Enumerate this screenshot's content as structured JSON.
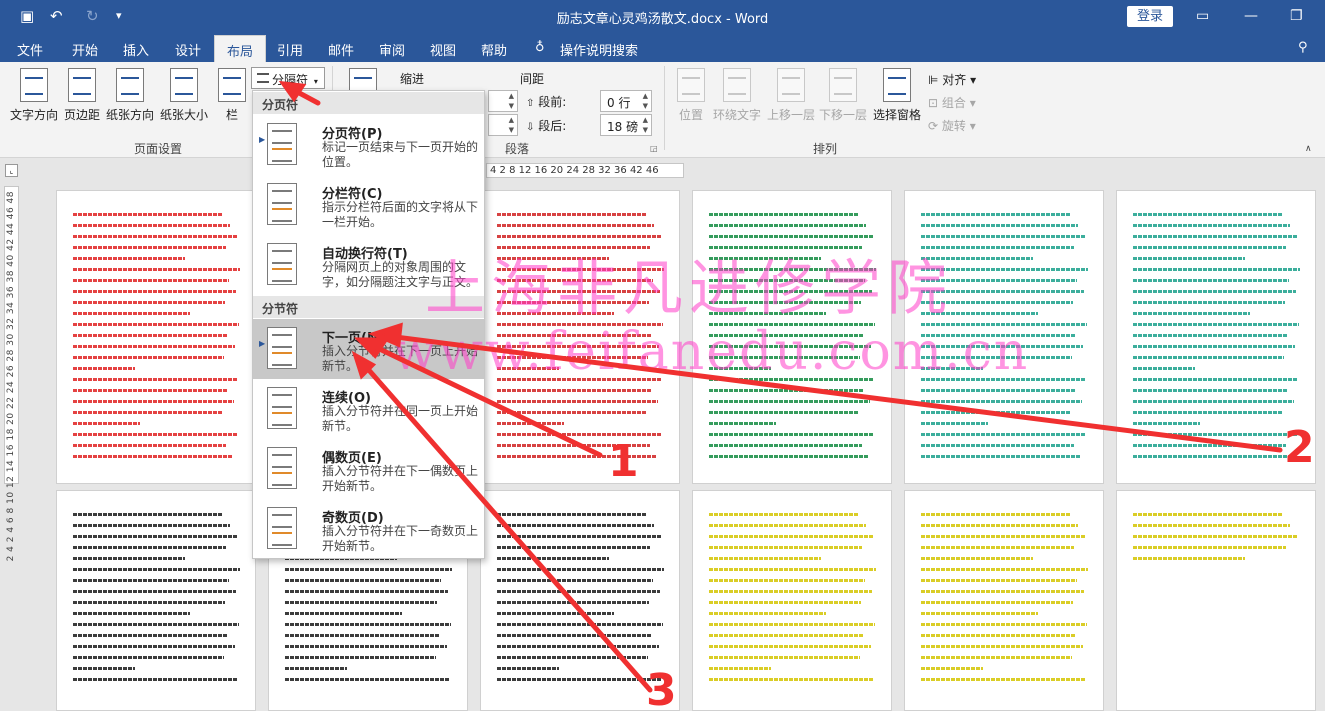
{
  "app": {
    "title": "励志文章心灵鸡汤散文.docx - Word",
    "login_label": "登录",
    "search_tab": "操作说明搜索"
  },
  "tabs": [
    {
      "label": "文件"
    },
    {
      "label": "开始"
    },
    {
      "label": "插入"
    },
    {
      "label": "设计"
    },
    {
      "label": "布局",
      "active": true
    },
    {
      "label": "引用"
    },
    {
      "label": "邮件"
    },
    {
      "label": "审阅"
    },
    {
      "label": "视图"
    },
    {
      "label": "帮助"
    }
  ],
  "ribbon": {
    "page_setup": {
      "group_label": "页面设置",
      "buttons": [
        "文字方向",
        "页边距",
        "纸张方向",
        "纸张大小",
        "栏"
      ],
      "breaks_button": "分隔符"
    },
    "indent": {
      "label": "缩进"
    },
    "spacing": {
      "label": "间距",
      "before_label": "段前:",
      "before_value": "0 行",
      "after_label": "段后:",
      "after_value": "18 磅"
    },
    "paragraph_group_label": "段落",
    "arrange": {
      "group_label": "排列",
      "buttons": [
        "位置",
        "环绕文字",
        "上移一层",
        "下移一层",
        "选择窗格"
      ],
      "align": "对齐",
      "group": "组合",
      "rotate": "旋转"
    }
  },
  "ruler": {
    "horizontal_ticks": "4  2  8 12 16 20 24 28 32 36  42 46",
    "vertical_ticks": "2 4 2 4 6 8 10 12 14 16 18 20 22 24 26 28 30 32 34 36 38 40 42 44 46 48"
  },
  "breaks_menu": {
    "page_breaks_header": "分页符",
    "section_breaks_header": "分节符",
    "items": [
      {
        "title": "分页符(P)",
        "desc": "标记一页结束与下一页开始的位置。"
      },
      {
        "title": "分栏符(C)",
        "desc": "指示分栏符后面的文字将从下一栏开始。"
      },
      {
        "title": "自动换行符(T)",
        "desc": "分隔网页上的对象周围的文字，如分隔题注文字与正文。"
      },
      {
        "title": "下一页(N)",
        "desc": "插入分节符并在下一页上开始新节。",
        "selected": true
      },
      {
        "title": "连续(O)",
        "desc": "插入分节符并在同一页上开始新节。"
      },
      {
        "title": "偶数页(E)",
        "desc": "插入分节符并在下一偶数页上开始新节。"
      },
      {
        "title": "奇数页(D)",
        "desc": "插入分节符并在下一奇数页上开始新节。"
      }
    ]
  },
  "watermark": {
    "line1": "上海非凡进修学院",
    "line2": "www.feifanedu.com.cn"
  },
  "callouts": [
    "1",
    "2",
    "3"
  ],
  "colors": {
    "accent": "#2b579a",
    "annotation": "#f03030",
    "watermark": "#ff3cc8"
  }
}
